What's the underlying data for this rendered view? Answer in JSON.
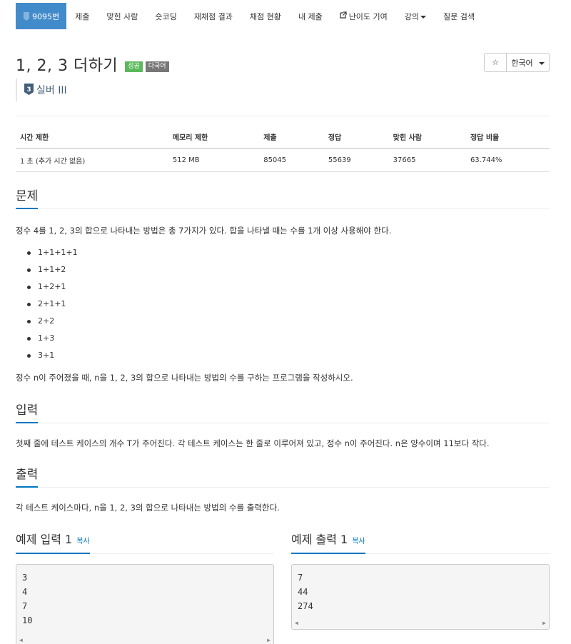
{
  "nav": {
    "problem_no": "9095번",
    "tier_badge": "3",
    "items": [
      "제출",
      "맞힌 사람",
      "숏코딩",
      "재채점 결과",
      "채점 현황",
      "내 제출",
      "난이도 기여",
      "강의",
      "질문 검색"
    ]
  },
  "problem": {
    "title": "1, 2, 3 더하기",
    "label_success": "성공",
    "label_lang": "다국어",
    "star": "☆",
    "lang_button": "한국어",
    "tier_num": "3",
    "tier": "실버 III"
  },
  "info": {
    "headers": [
      "시간 제한",
      "메모리 제한",
      "제출",
      "정답",
      "맞힌 사람",
      "정답 비율"
    ],
    "values": [
      "1 초 (추가 시간 없음)",
      "512 MB",
      "85045",
      "55639",
      "37665",
      "63.744%"
    ]
  },
  "sections": {
    "problem_title": "문제",
    "problem_desc": "정수 4를 1, 2, 3의 합으로 나타내는 방법은 총 7가지가 있다. 합을 나타낼 때는 수를 1개 이상 사용해야 한다.",
    "sums": [
      "1+1+1+1",
      "1+1+2",
      "1+2+1",
      "2+1+1",
      "2+2",
      "1+3",
      "3+1"
    ],
    "problem_task": "정수 n이 주어졌을 때, n을 1, 2, 3의 합으로 나타내는 방법의 수를 구하는 프로그램을 작성하시오.",
    "input_title": "입력",
    "input_desc": "첫째 줄에 테스트 케이스의 개수 T가 주어진다. 각 테스트 케이스는 한 줄로 이루어져 있고, 정수 n이 주어진다. n은 양수이며 11보다 작다.",
    "output_title": "출력",
    "output_desc": "각 테스트 케이스마다, n을 1, 2, 3의 합으로 나타내는 방법의 수를 출력한다."
  },
  "samples": {
    "input_title": "예제 입력 1",
    "output_title": "예제 출력 1",
    "copy": "복사",
    "input": [
      "3",
      "4",
      "7",
      "10"
    ],
    "output": [
      "7",
      "44",
      "274"
    ]
  },
  "colors": {
    "accent": "#428bca",
    "link": "#0076c0",
    "success": "#5cb85c",
    "label": "#777777"
  }
}
